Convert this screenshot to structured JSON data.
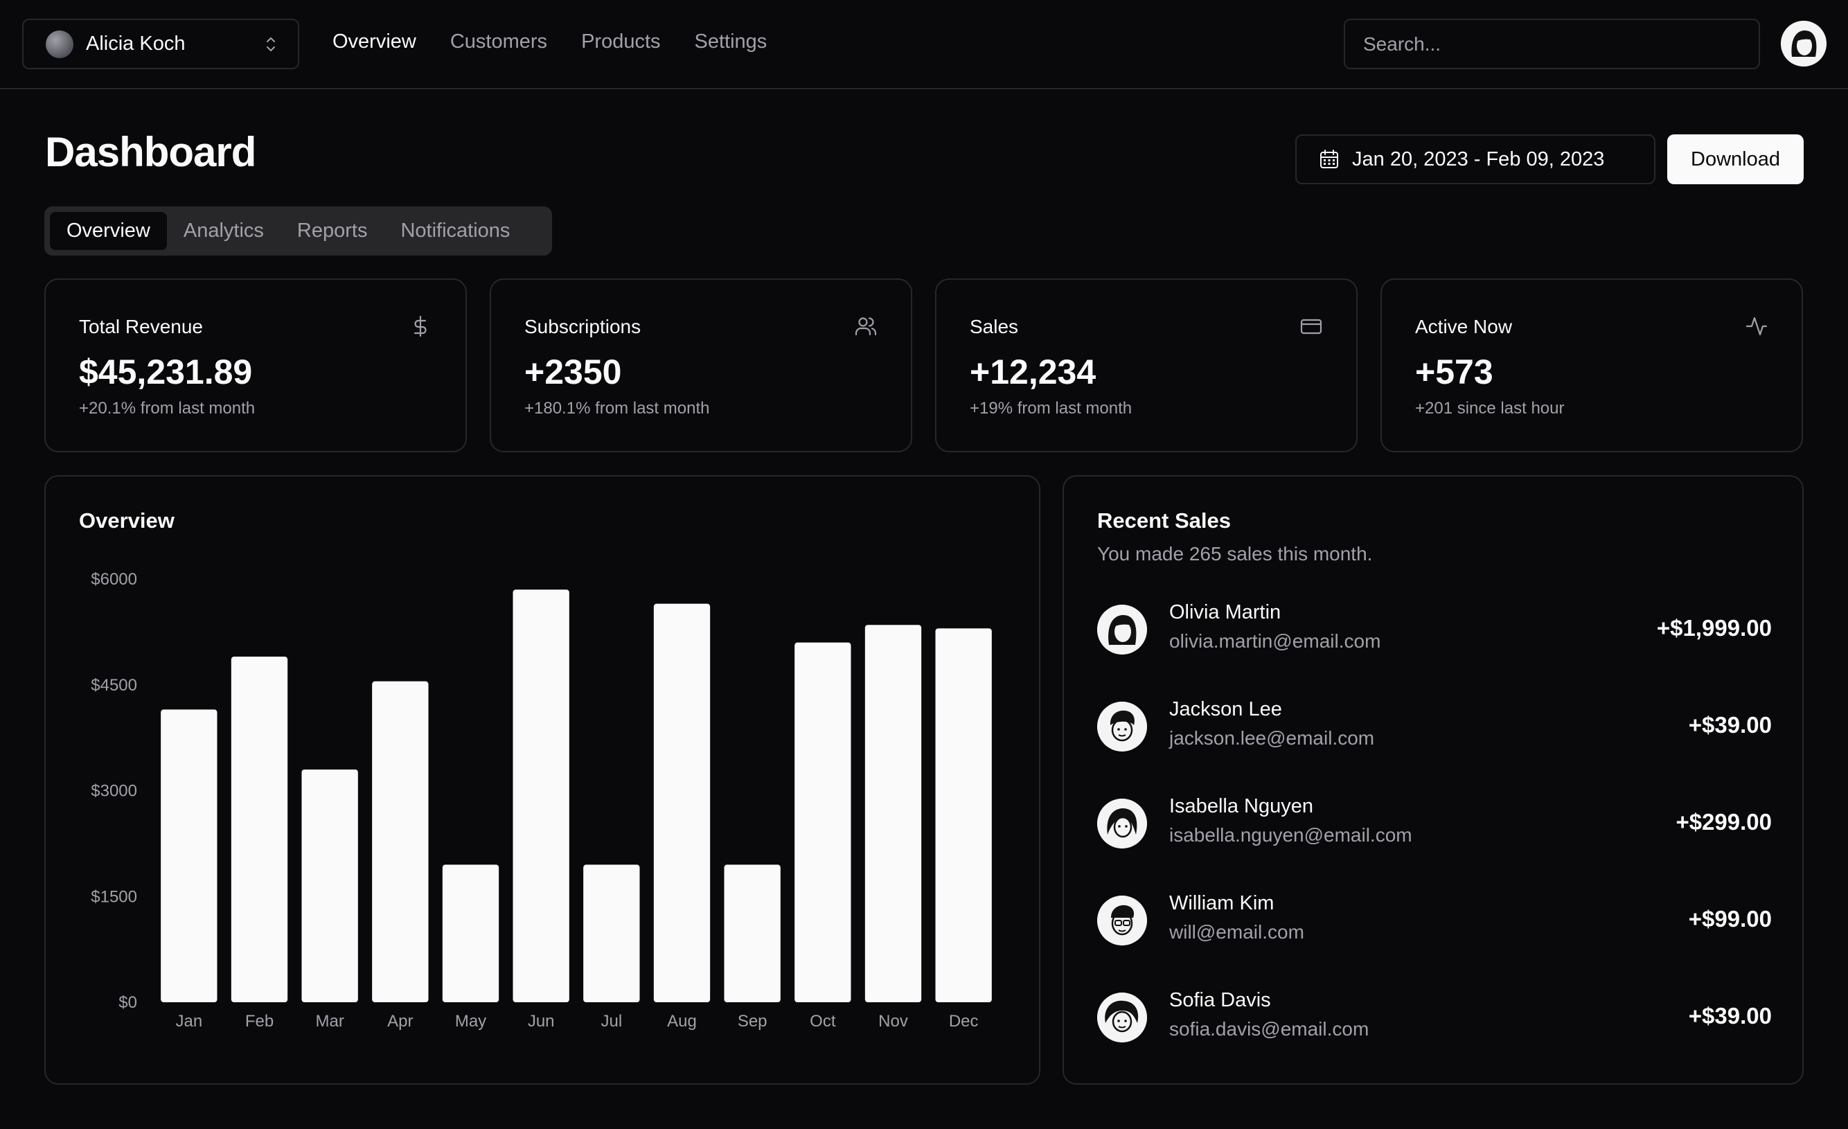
{
  "topbar": {
    "team": {
      "name": "Alicia Koch"
    },
    "nav": [
      {
        "label": "Overview",
        "active": true
      },
      {
        "label": "Customers",
        "active": false
      },
      {
        "label": "Products",
        "active": false
      },
      {
        "label": "Settings",
        "active": false
      }
    ],
    "search": {
      "placeholder": "Search...",
      "value": ""
    }
  },
  "header": {
    "title": "Dashboard",
    "date_range": "Jan 20, 2023 - Feb 09, 2023",
    "download_label": "Download"
  },
  "tabs": [
    {
      "label": "Overview",
      "active": true
    },
    {
      "label": "Analytics",
      "active": false
    },
    {
      "label": "Reports",
      "active": false
    },
    {
      "label": "Notifications",
      "active": false
    }
  ],
  "stats": [
    {
      "label": "Total Revenue",
      "value": "$45,231.89",
      "sub": "+20.1% from last month",
      "icon": "dollar-icon"
    },
    {
      "label": "Subscriptions",
      "value": "+2350",
      "sub": "+180.1% from last month",
      "icon": "users-icon"
    },
    {
      "label": "Sales",
      "value": "+12,234",
      "sub": "+19% from last month",
      "icon": "credit-card-icon"
    },
    {
      "label": "Active Now",
      "value": "+573",
      "sub": "+201 since last hour",
      "icon": "activity-icon"
    }
  ],
  "overview": {
    "title": "Overview"
  },
  "chart_data": {
    "type": "bar",
    "categories": [
      "Jan",
      "Feb",
      "Mar",
      "Apr",
      "May",
      "Jun",
      "Jul",
      "Aug",
      "Sep",
      "Oct",
      "Nov",
      "Dec"
    ],
    "values": [
      4150,
      4900,
      3300,
      4550,
      1950,
      5850,
      1950,
      5650,
      1950,
      5100,
      5350,
      5300
    ],
    "yticks": [
      "$0",
      "$1500",
      "$3000",
      "$4500",
      "$6000"
    ],
    "ytick_values": [
      0,
      1500,
      3000,
      4500,
      6000
    ],
    "ylim": [
      0,
      6000
    ],
    "title": "Overview",
    "xlabel": "",
    "ylabel": "",
    "grid": false,
    "bar_color": "#fafafa"
  },
  "recent_sales": {
    "title": "Recent Sales",
    "subtitle": "You made 265 sales this month.",
    "items": [
      {
        "name": "Olivia Martin",
        "email": "olivia.martin@email.com",
        "amount": "+$1,999.00"
      },
      {
        "name": "Jackson Lee",
        "email": "jackson.lee@email.com",
        "amount": "+$39.00"
      },
      {
        "name": "Isabella Nguyen",
        "email": "isabella.nguyen@email.com",
        "amount": "+$299.00"
      },
      {
        "name": "William Kim",
        "email": "will@email.com",
        "amount": "+$99.00"
      },
      {
        "name": "Sofia Davis",
        "email": "sofia.davis@email.com",
        "amount": "+$39.00"
      }
    ]
  },
  "colors": {
    "background": "#09090b",
    "border": "#27272a",
    "foreground": "#fafafa",
    "muted": "#a1a1aa"
  }
}
